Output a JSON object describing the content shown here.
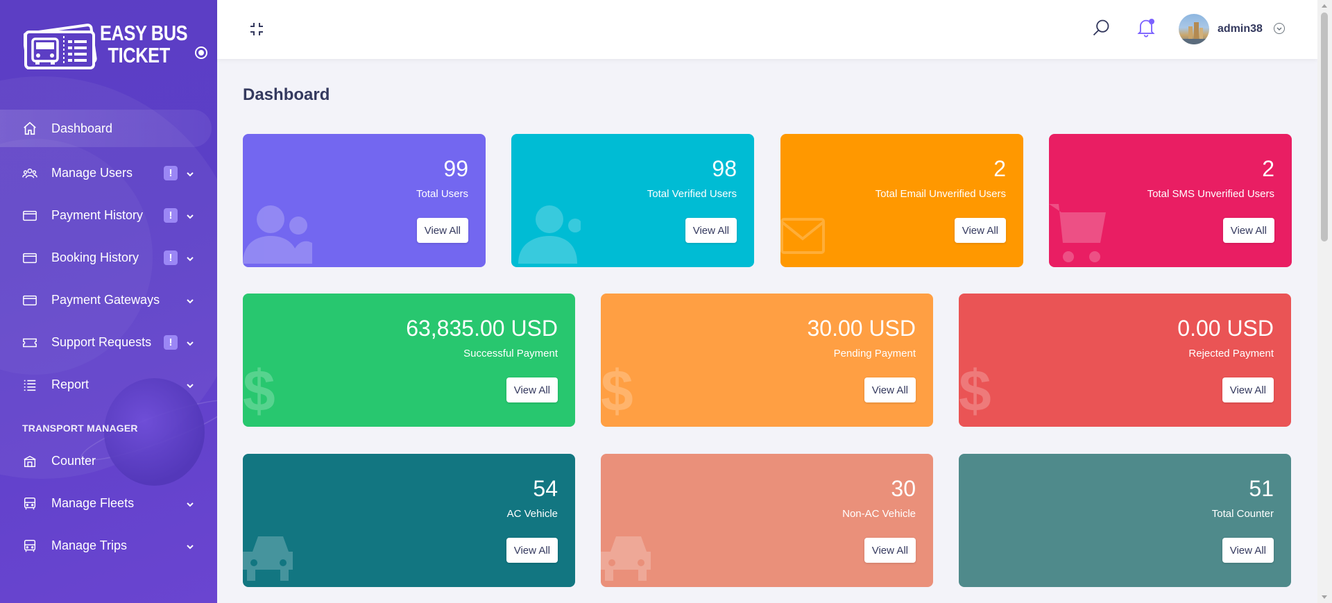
{
  "brand": {
    "line1": "EASY BUS",
    "line2": "TICKET"
  },
  "sidebar": {
    "items": [
      {
        "label": "Dashboard",
        "icon": "home-icon",
        "active": true
      },
      {
        "label": "Manage Users",
        "icon": "users-icon",
        "badge": "!",
        "has_children": true
      },
      {
        "label": "Payment History",
        "icon": "credit-card-icon",
        "badge": "!",
        "has_children": true
      },
      {
        "label": "Booking History",
        "icon": "credit-card-icon",
        "badge": "!",
        "has_children": true
      },
      {
        "label": "Payment Gateways",
        "icon": "credit-card-icon",
        "has_children": true
      },
      {
        "label": "Support Requests",
        "icon": "ticket-icon",
        "badge": "!",
        "has_children": true
      },
      {
        "label": "Report",
        "icon": "list-icon",
        "has_children": true
      }
    ],
    "section_title": "TRANSPORT MANAGER",
    "section_items": [
      {
        "label": "Counter",
        "icon": "building-icon"
      },
      {
        "label": "Manage Fleets",
        "icon": "bus-icon",
        "has_children": true
      },
      {
        "label": "Manage Trips",
        "icon": "bus-icon",
        "has_children": true
      }
    ]
  },
  "topbar": {
    "username": "admin38",
    "notification_color": "#7b61ff"
  },
  "page": {
    "title": "Dashboard"
  },
  "cards": {
    "total_users": {
      "value": "99",
      "label": "Total Users",
      "button": "View All",
      "color": "#7367f0"
    },
    "verified_users": {
      "value": "98",
      "label": "Total Verified Users",
      "button": "View All",
      "color": "#00bcd4"
    },
    "email_unverified": {
      "value": "2",
      "label": "Total Email Unverified Users",
      "button": "View All",
      "color": "#ff9800"
    },
    "sms_unverified": {
      "value": "2",
      "label": "Total SMS Unverified Users",
      "button": "View All",
      "color": "#e91e63"
    },
    "successful_payment": {
      "value": "63,835.00 USD",
      "label": "Successful Payment",
      "button": "View All",
      "color": "#28c76f"
    },
    "pending_payment": {
      "value": "30.00 USD",
      "label": "Pending Payment",
      "button": "View All",
      "color": "#ff9f43"
    },
    "rejected_payment": {
      "value": "0.00 USD",
      "label": "Rejected Payment",
      "button": "View All",
      "color": "#ea5455"
    },
    "ac_vehicle": {
      "value": "54",
      "label": "AC Vehicle",
      "button": "View All",
      "color": "#127681"
    },
    "non_ac_vehicle": {
      "value": "30",
      "label": "Non-AC Vehicle",
      "button": "View All",
      "color": "#ea907a"
    },
    "total_counter": {
      "value": "51",
      "label": "Total Counter",
      "button": "View All",
      "color": "#4f8a8b"
    }
  }
}
